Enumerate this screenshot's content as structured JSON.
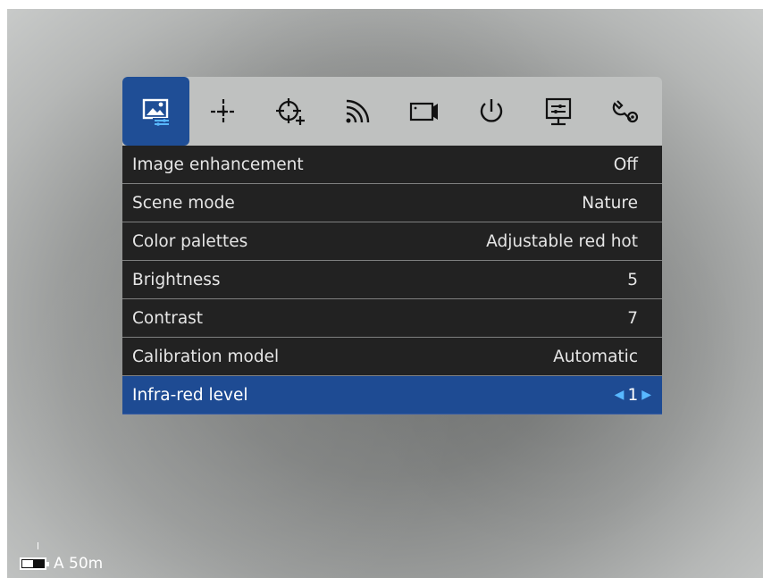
{
  "tabs": [
    {
      "icon": "image-settings-icon",
      "active": true
    },
    {
      "icon": "crosshair-icon",
      "active": false
    },
    {
      "icon": "target-add-icon",
      "active": false
    },
    {
      "icon": "wifi-signal-icon",
      "active": false
    },
    {
      "icon": "video-camera-icon",
      "active": false
    },
    {
      "icon": "power-icon",
      "active": false
    },
    {
      "icon": "display-settings-icon",
      "active": false
    },
    {
      "icon": "system-settings-icon",
      "active": false
    }
  ],
  "menu": {
    "rows": [
      {
        "label": "Image enhancement",
        "value": "Off"
      },
      {
        "label": "Scene mode",
        "value": "Nature"
      },
      {
        "label": "Color palettes",
        "value": "Adjustable red hot"
      },
      {
        "label": "Brightness",
        "value": "5"
      },
      {
        "label": "Contrast",
        "value": "7"
      },
      {
        "label": "Calibration model",
        "value": "Automatic"
      }
    ],
    "selected": {
      "label": "Infra-red level",
      "value": "1",
      "left_arrow": "◀",
      "right_arrow": "▶"
    }
  },
  "status": {
    "range_label": "A 50m",
    "battery_level": 0.5
  },
  "colors": {
    "accent": "#1f4e96",
    "highlight_arrow": "#58b8ff",
    "row_bg": "#222222",
    "tabbar_bg": "#bfc1c0"
  }
}
